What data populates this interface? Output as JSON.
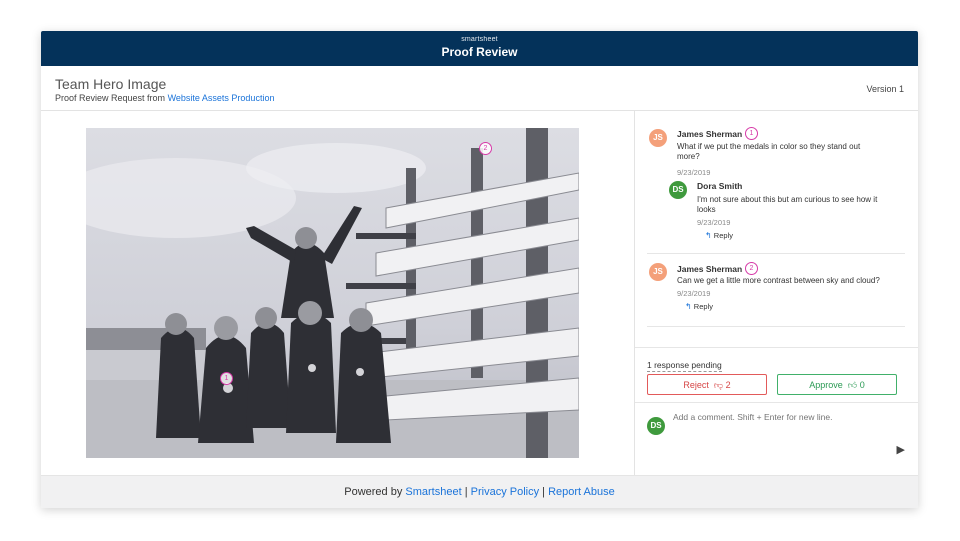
{
  "header": {
    "brand": "smartsheet",
    "title": "Proof Review"
  },
  "document": {
    "title": "Team Hero Image",
    "request_prefix": "Proof Review Request from",
    "request_source": "Website Assets Production",
    "version": "Version 1"
  },
  "pins": {
    "pin1": "1",
    "pin2": "2"
  },
  "comments": [
    {
      "initials": "JS",
      "author": "James Sherman",
      "pin": "1",
      "text": "What if we put the medals in color so they stand out more?",
      "date": "9/23/2019",
      "reply": {
        "initials": "DS",
        "author": "Dora Smith",
        "text": "I'm not sure about this but am curious to see how it looks",
        "date": "9/23/2019",
        "reply_label": "Reply"
      }
    },
    {
      "initials": "JS",
      "author": "James Sherman",
      "pin": "2",
      "text": "Can we get a little more contrast between sky and cloud?",
      "date": "9/23/2019",
      "reply_label": "Reply"
    }
  ],
  "review": {
    "pending": "1 response pending",
    "reject_label": "Reject",
    "reject_count": "2",
    "approve_label": "Approve",
    "approve_count": "0"
  },
  "composer": {
    "initials": "DS",
    "placeholder": "Add a comment. Shift + Enter for new line."
  },
  "footer": {
    "powered_by": "Powered by",
    "smartsheet": "Smartsheet",
    "privacy": "Privacy Policy",
    "abuse": "Report Abuse",
    "separator": "|"
  }
}
